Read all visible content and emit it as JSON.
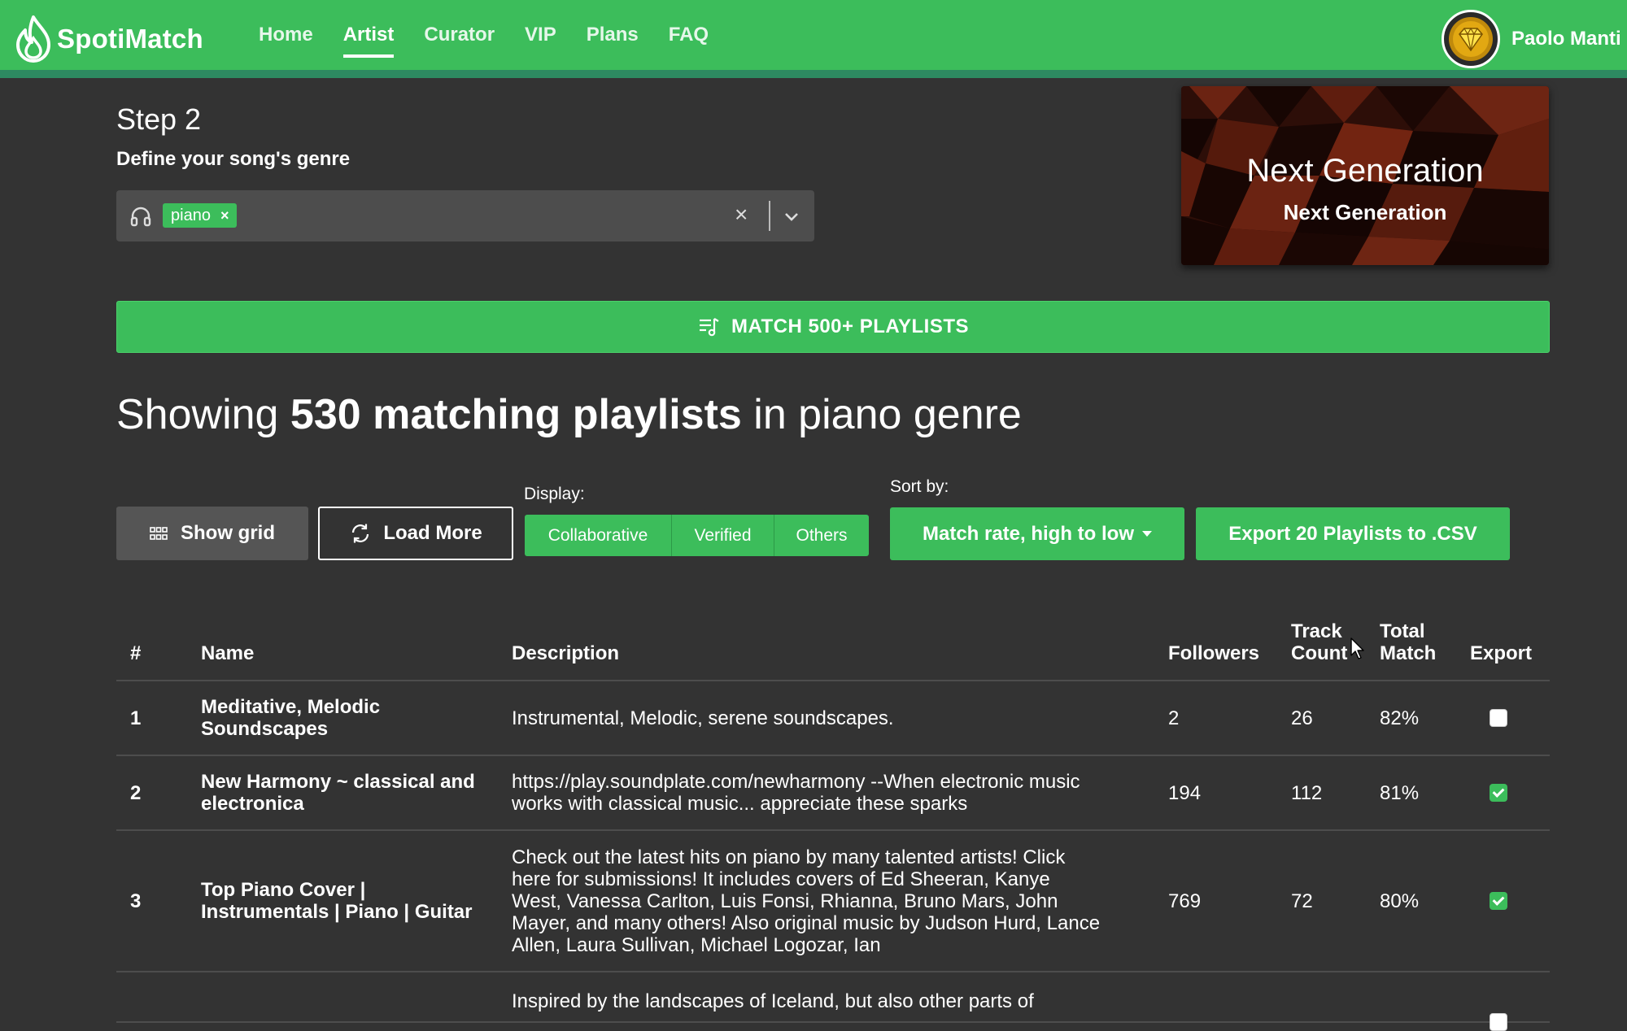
{
  "nav": {
    "brand": "SpotiMatch",
    "links": [
      {
        "label": "Home",
        "active": false
      },
      {
        "label": "Artist",
        "active": true
      },
      {
        "label": "Curator",
        "active": false
      },
      {
        "label": "VIP",
        "active": false
      },
      {
        "label": "Plans",
        "active": false
      },
      {
        "label": "FAQ",
        "active": false
      }
    ],
    "user_name": "Paolo Manti"
  },
  "step": {
    "title": "Step 2",
    "subtitle": "Define your song's genre",
    "genre_tag": "piano",
    "tag_remove": "×",
    "clear": "×"
  },
  "banner": {
    "title": "Next Generation",
    "subtitle": "Next Generation"
  },
  "match_button": "MATCH 500+ PLAYLISTS",
  "results": {
    "prefix": "Showing ",
    "count_text": "530 matching playlists",
    "suffix": " in piano genre"
  },
  "controls": {
    "show_grid": "Show grid",
    "load_more": "Load More",
    "display_label": "Display:",
    "display_options": [
      "Collaborative",
      "Verified",
      "Others"
    ],
    "sort_label": "Sort by:",
    "sort_value": "Match rate, high to low",
    "export": "Export 20 Playlists to .CSV"
  },
  "table": {
    "headers": {
      "num": "#",
      "name": "Name",
      "description": "Description",
      "followers": "Followers",
      "track_count_1": "Track",
      "track_count_2": "Count",
      "total_match_1": "Total",
      "total_match_2": "Match",
      "export": "Export"
    },
    "rows": [
      {
        "num": "1",
        "name": [
          "Meditative, Melodic",
          "Soundscapes"
        ],
        "description": [
          "Instrumental, Melodic, serene soundscapes."
        ],
        "followers": "2",
        "tracks": "26",
        "match": "82%",
        "export": false
      },
      {
        "num": "2",
        "name": [
          "New Harmony ~ classical and",
          "electronica"
        ],
        "description": [
          "https://play.soundplate.com/newharmony --When electronic music",
          "works with classical music... appreciate these sparks"
        ],
        "followers": "194",
        "tracks": "112",
        "match": "81%",
        "export": true
      },
      {
        "num": "3",
        "name": [
          "Top Piano Cover |",
          "Instrumentals | Piano | Guitar"
        ],
        "description": [
          "Check out the latest hits on piano by many talented artists! Click",
          "here for submissions! It includes covers of Ed Sheeran, Kanye",
          "West, Vanessa Carlton, Luis Fonsi, Rhianna, Bruno Mars, John",
          "Mayer, and many others! Also original music by Judson Hurd, Lance",
          "Allen, Laura Sullivan, Michael Logozar, Ian"
        ],
        "followers": "769",
        "tracks": "72",
        "match": "80%",
        "export": true
      },
      {
        "num": "",
        "name": [
          ""
        ],
        "description": [
          "Inspired by the landscapes of Iceland, but also other parts of"
        ],
        "followers": "",
        "tracks": "",
        "match": "",
        "export": false
      }
    ]
  },
  "colors": {
    "brand_green": "#3cbd5b",
    "nav_border": "#2d8a61",
    "background": "#333333"
  }
}
